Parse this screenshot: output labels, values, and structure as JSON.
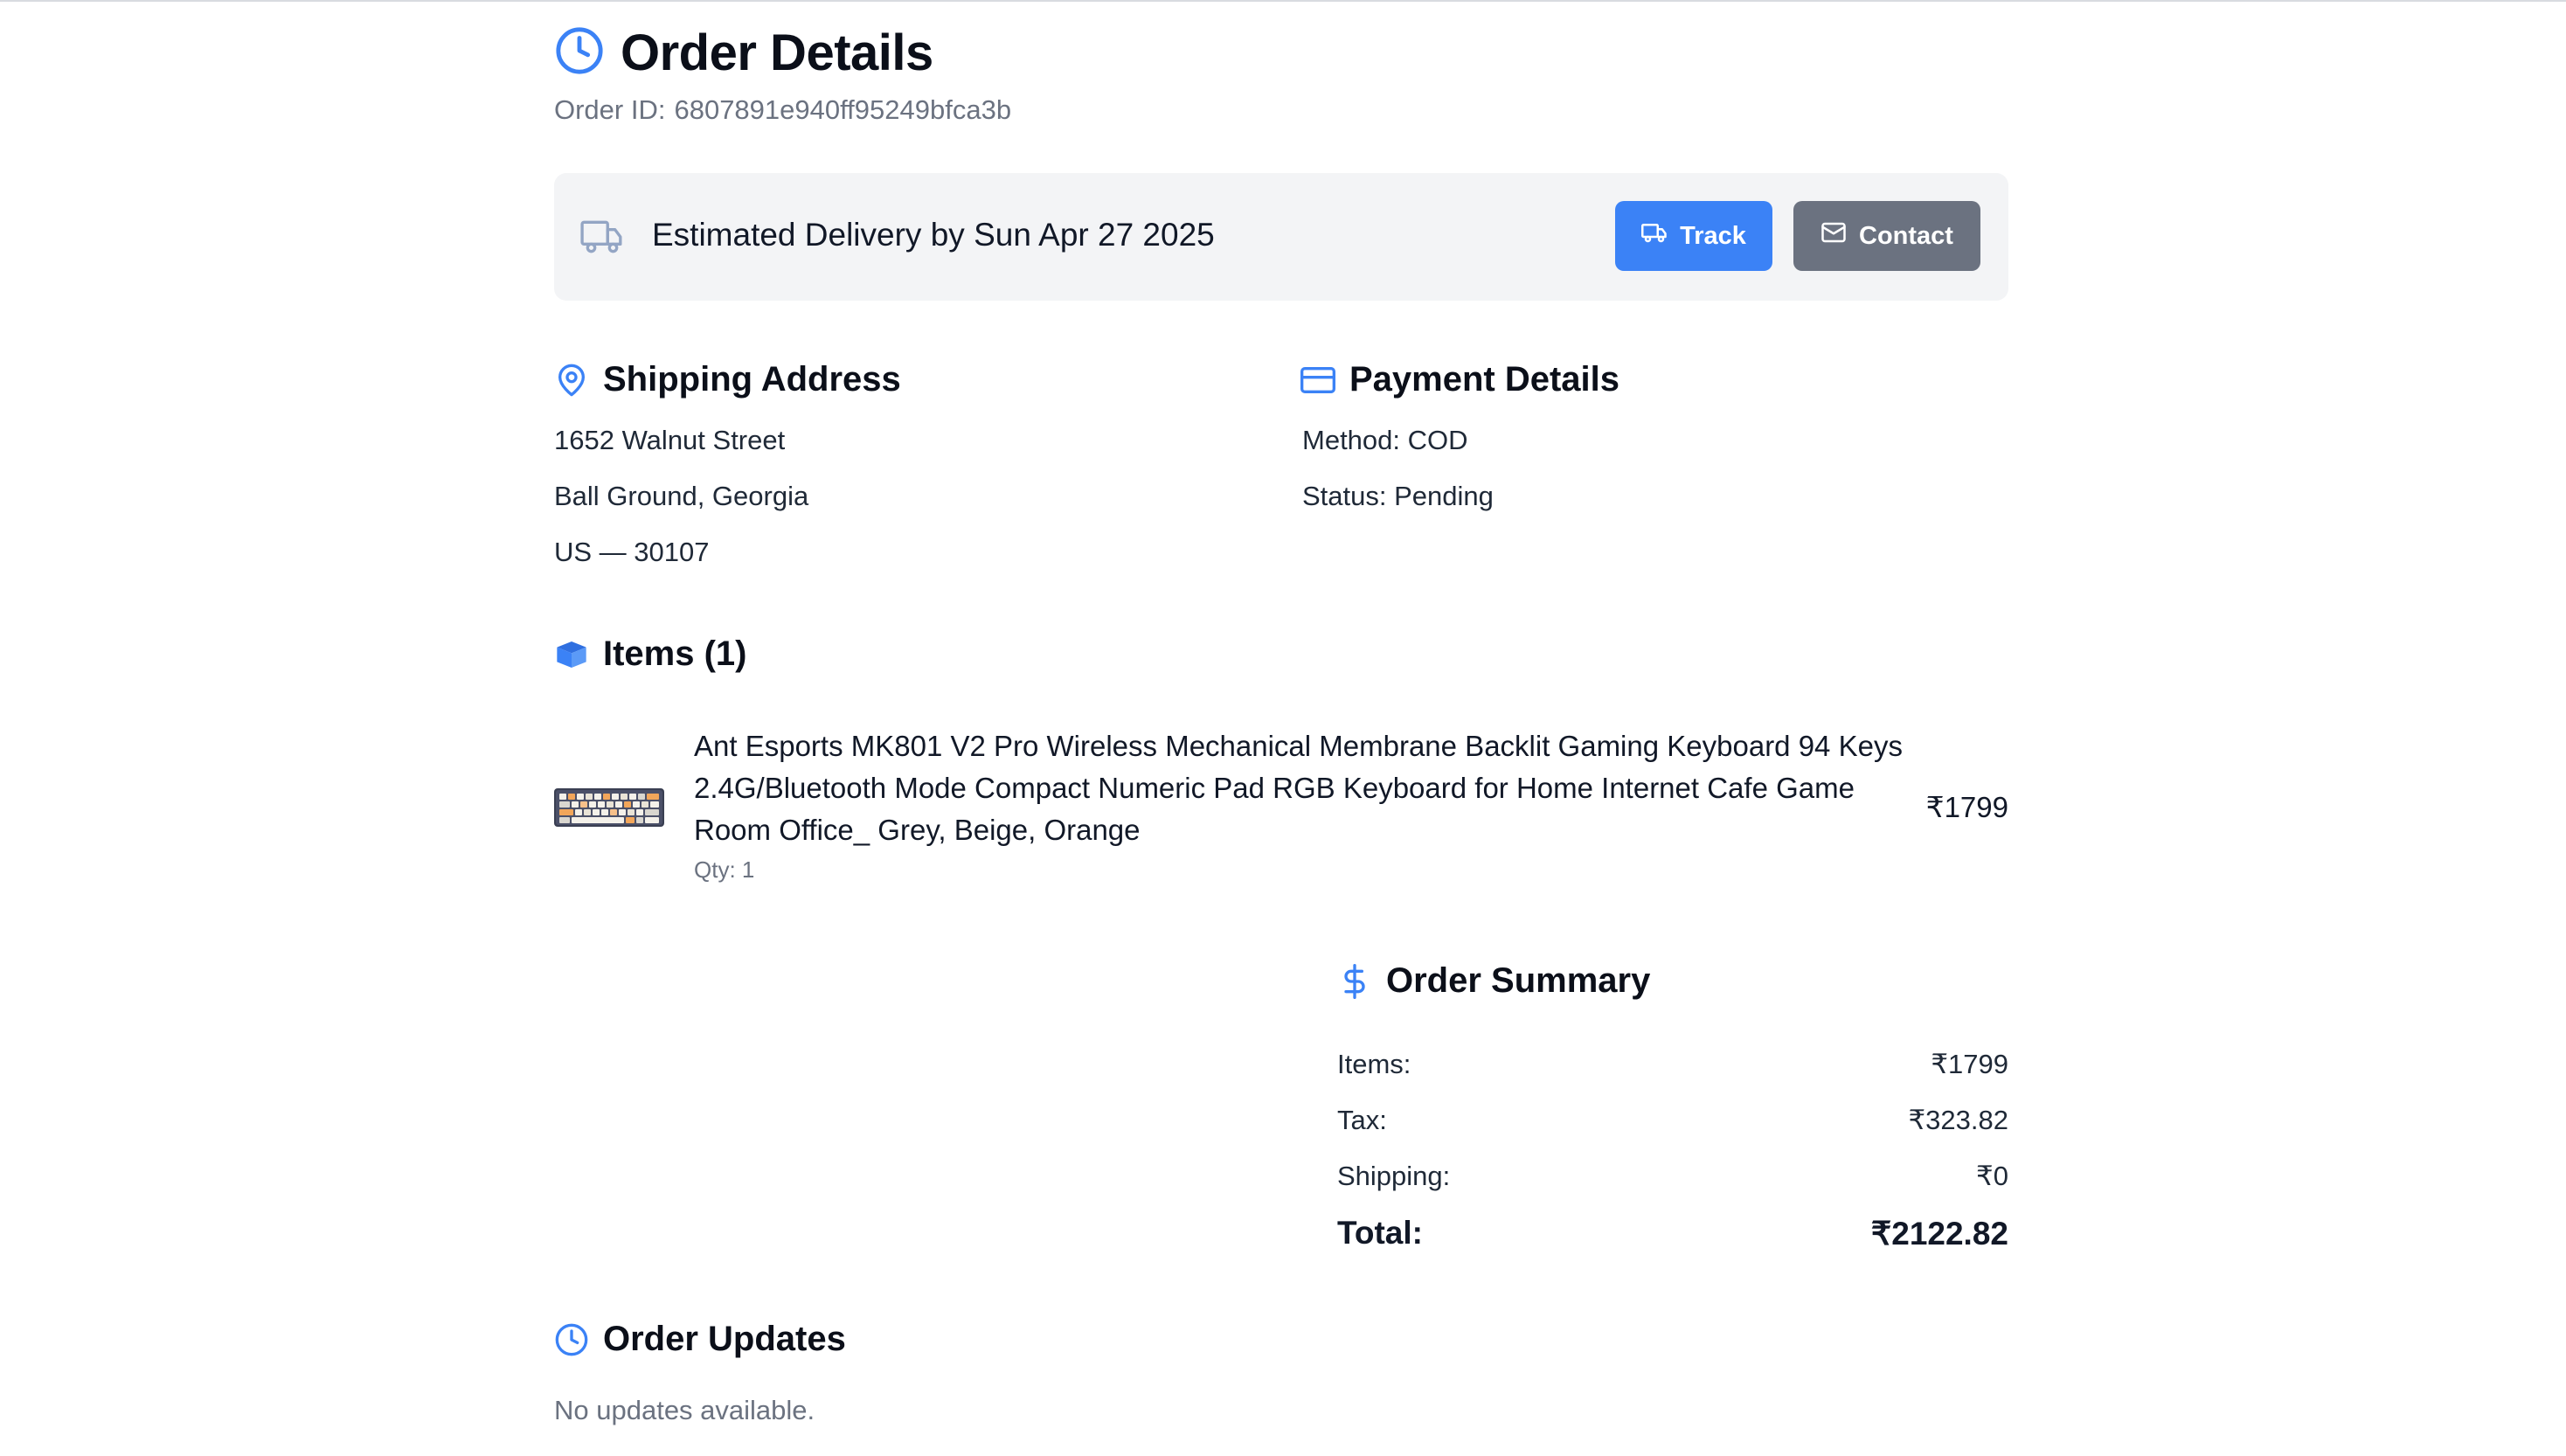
{
  "header": {
    "title": "Order Details",
    "order_id_label": "Order ID:",
    "order_id": "6807891e940ff95249bfca3b"
  },
  "delivery": {
    "text": "Estimated Delivery by Sun Apr 27 2025",
    "track_label": "Track",
    "contact_label": "Contact"
  },
  "shipping": {
    "title": "Shipping Address",
    "street": "1652 Walnut Street",
    "city_state": "Ball Ground, Georgia",
    "country_zip": "US — 30107"
  },
  "payment": {
    "title": "Payment Details",
    "method": "Method: COD",
    "status": "Status: Pending"
  },
  "items": {
    "title": "Items (1)",
    "list": [
      {
        "name": "Ant Esports MK801 V2 Pro Wireless Mechanical Membrane Backlit Gaming Keyboard 94 Keys 2.4G/Bluetooth Mode Compact Numeric Pad RGB Keyboard for Home Internet Cafe Game Room Office_ Grey, Beige, Orange",
        "qty": "Qty: 1",
        "price": "₹1799"
      }
    ]
  },
  "summary": {
    "title": "Order Summary",
    "rows": [
      {
        "label": "Items:",
        "value": "₹1799"
      },
      {
        "label": "Tax:",
        "value": "₹323.82"
      },
      {
        "label": "Shipping:",
        "value": "₹0"
      }
    ],
    "total_label": "Total:",
    "total_value": "₹2122.82"
  },
  "updates": {
    "title": "Order Updates",
    "empty_text": "No updates available."
  },
  "colors": {
    "accent": "#3b82f6",
    "secondary_button": "#6b7280",
    "banner_bg": "#f3f4f6",
    "muted_text": "#6b7280"
  },
  "icons": {
    "title": "clock-icon",
    "delivery": "truck-icon",
    "track": "truck-icon",
    "contact": "mail-icon",
    "shipping": "map-pin-icon",
    "payment": "credit-card-icon",
    "items": "box-icon",
    "summary": "dollar-icon",
    "updates": "clock-icon"
  }
}
